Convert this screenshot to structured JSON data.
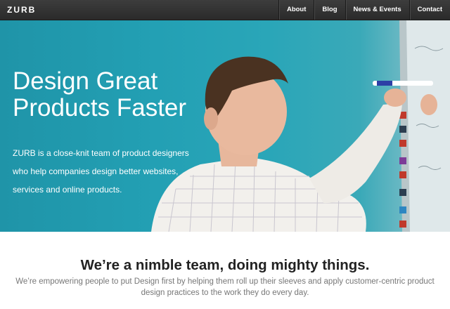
{
  "header": {
    "logo": "ZURB",
    "nav": [
      {
        "label": "About"
      },
      {
        "label": "Blog"
      },
      {
        "label": "News & Events"
      },
      {
        "label": "Contact"
      }
    ]
  },
  "hero": {
    "title_line1": "Design Great",
    "title_line2": "Products Faster",
    "description": "ZURB is a close-knit team of product designers who help companies design better websites, services and online products."
  },
  "intro": {
    "heading": "We’re a nimble team, doing mighty things.",
    "text": "We’re empowering people to put Design first by helping them roll up their sleeves and apply customer-centric product design practices to the work they do every day."
  },
  "colors": {
    "nav_bg": "#333333",
    "hero_teal": "#23a0b4",
    "heading_text": "#222222",
    "body_text": "#777777"
  }
}
